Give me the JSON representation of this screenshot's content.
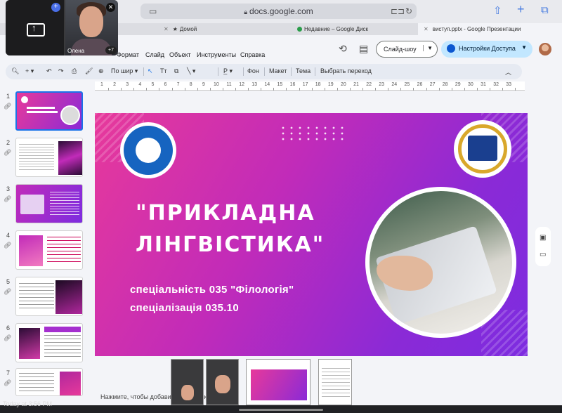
{
  "browser": {
    "url": "docs.google.com",
    "tabs": [
      {
        "label": "Домой",
        "active": false
      },
      {
        "label": "Недавние – Google Диск",
        "active": false
      },
      {
        "label": "виступ.pptx - Google Презентации",
        "active": true
      }
    ]
  },
  "menu": [
    "Формат",
    "Слайд",
    "Объект",
    "Инструменты",
    "Справка"
  ],
  "header": {
    "slideshow_label": "Слайд-шоу",
    "access_label": "Настройки Доступа"
  },
  "toolbar": {
    "zoom_label": "По шир",
    "background_label": "Фон",
    "layout_label": "Макет",
    "theme_label": "Тема",
    "transition_label": "Выбрать переход"
  },
  "ruler": [
    "1",
    "2",
    "3",
    "4",
    "5",
    "6",
    "7",
    "8",
    "9",
    "10",
    "11",
    "12",
    "13",
    "14",
    "15",
    "16",
    "17",
    "18",
    "19",
    "20",
    "21",
    "22",
    "23",
    "24",
    "25",
    "26",
    "27",
    "28",
    "29",
    "30",
    "31",
    "32",
    "33"
  ],
  "filmstrip": [
    {
      "number": "1",
      "selected": true
    },
    {
      "number": "2",
      "selected": false
    },
    {
      "number": "3",
      "selected": false
    },
    {
      "number": "4",
      "selected": false
    },
    {
      "number": "5",
      "selected": false
    },
    {
      "number": "6",
      "selected": false
    },
    {
      "number": "7",
      "selected": false
    }
  ],
  "slide": {
    "title_line1": "\"ПРИКЛАДНА",
    "title_line2": "ЛІНГВІСТИКА\"",
    "subtitle_line1": "спеціальність 035 \"Філологія\"",
    "subtitle_line2": "спеціалізація 035.10",
    "colors": {
      "gradient_start": "#e7399b",
      "gradient_end": "#7d2ce0"
    }
  },
  "notes": {
    "placeholder": "Нажмите, чтобы добавить заметки к слайду"
  },
  "video_call": {
    "participant_name": "Олена",
    "extra_count": "+7"
  },
  "status": {
    "timestamp": "Today at 3:56 PM"
  }
}
